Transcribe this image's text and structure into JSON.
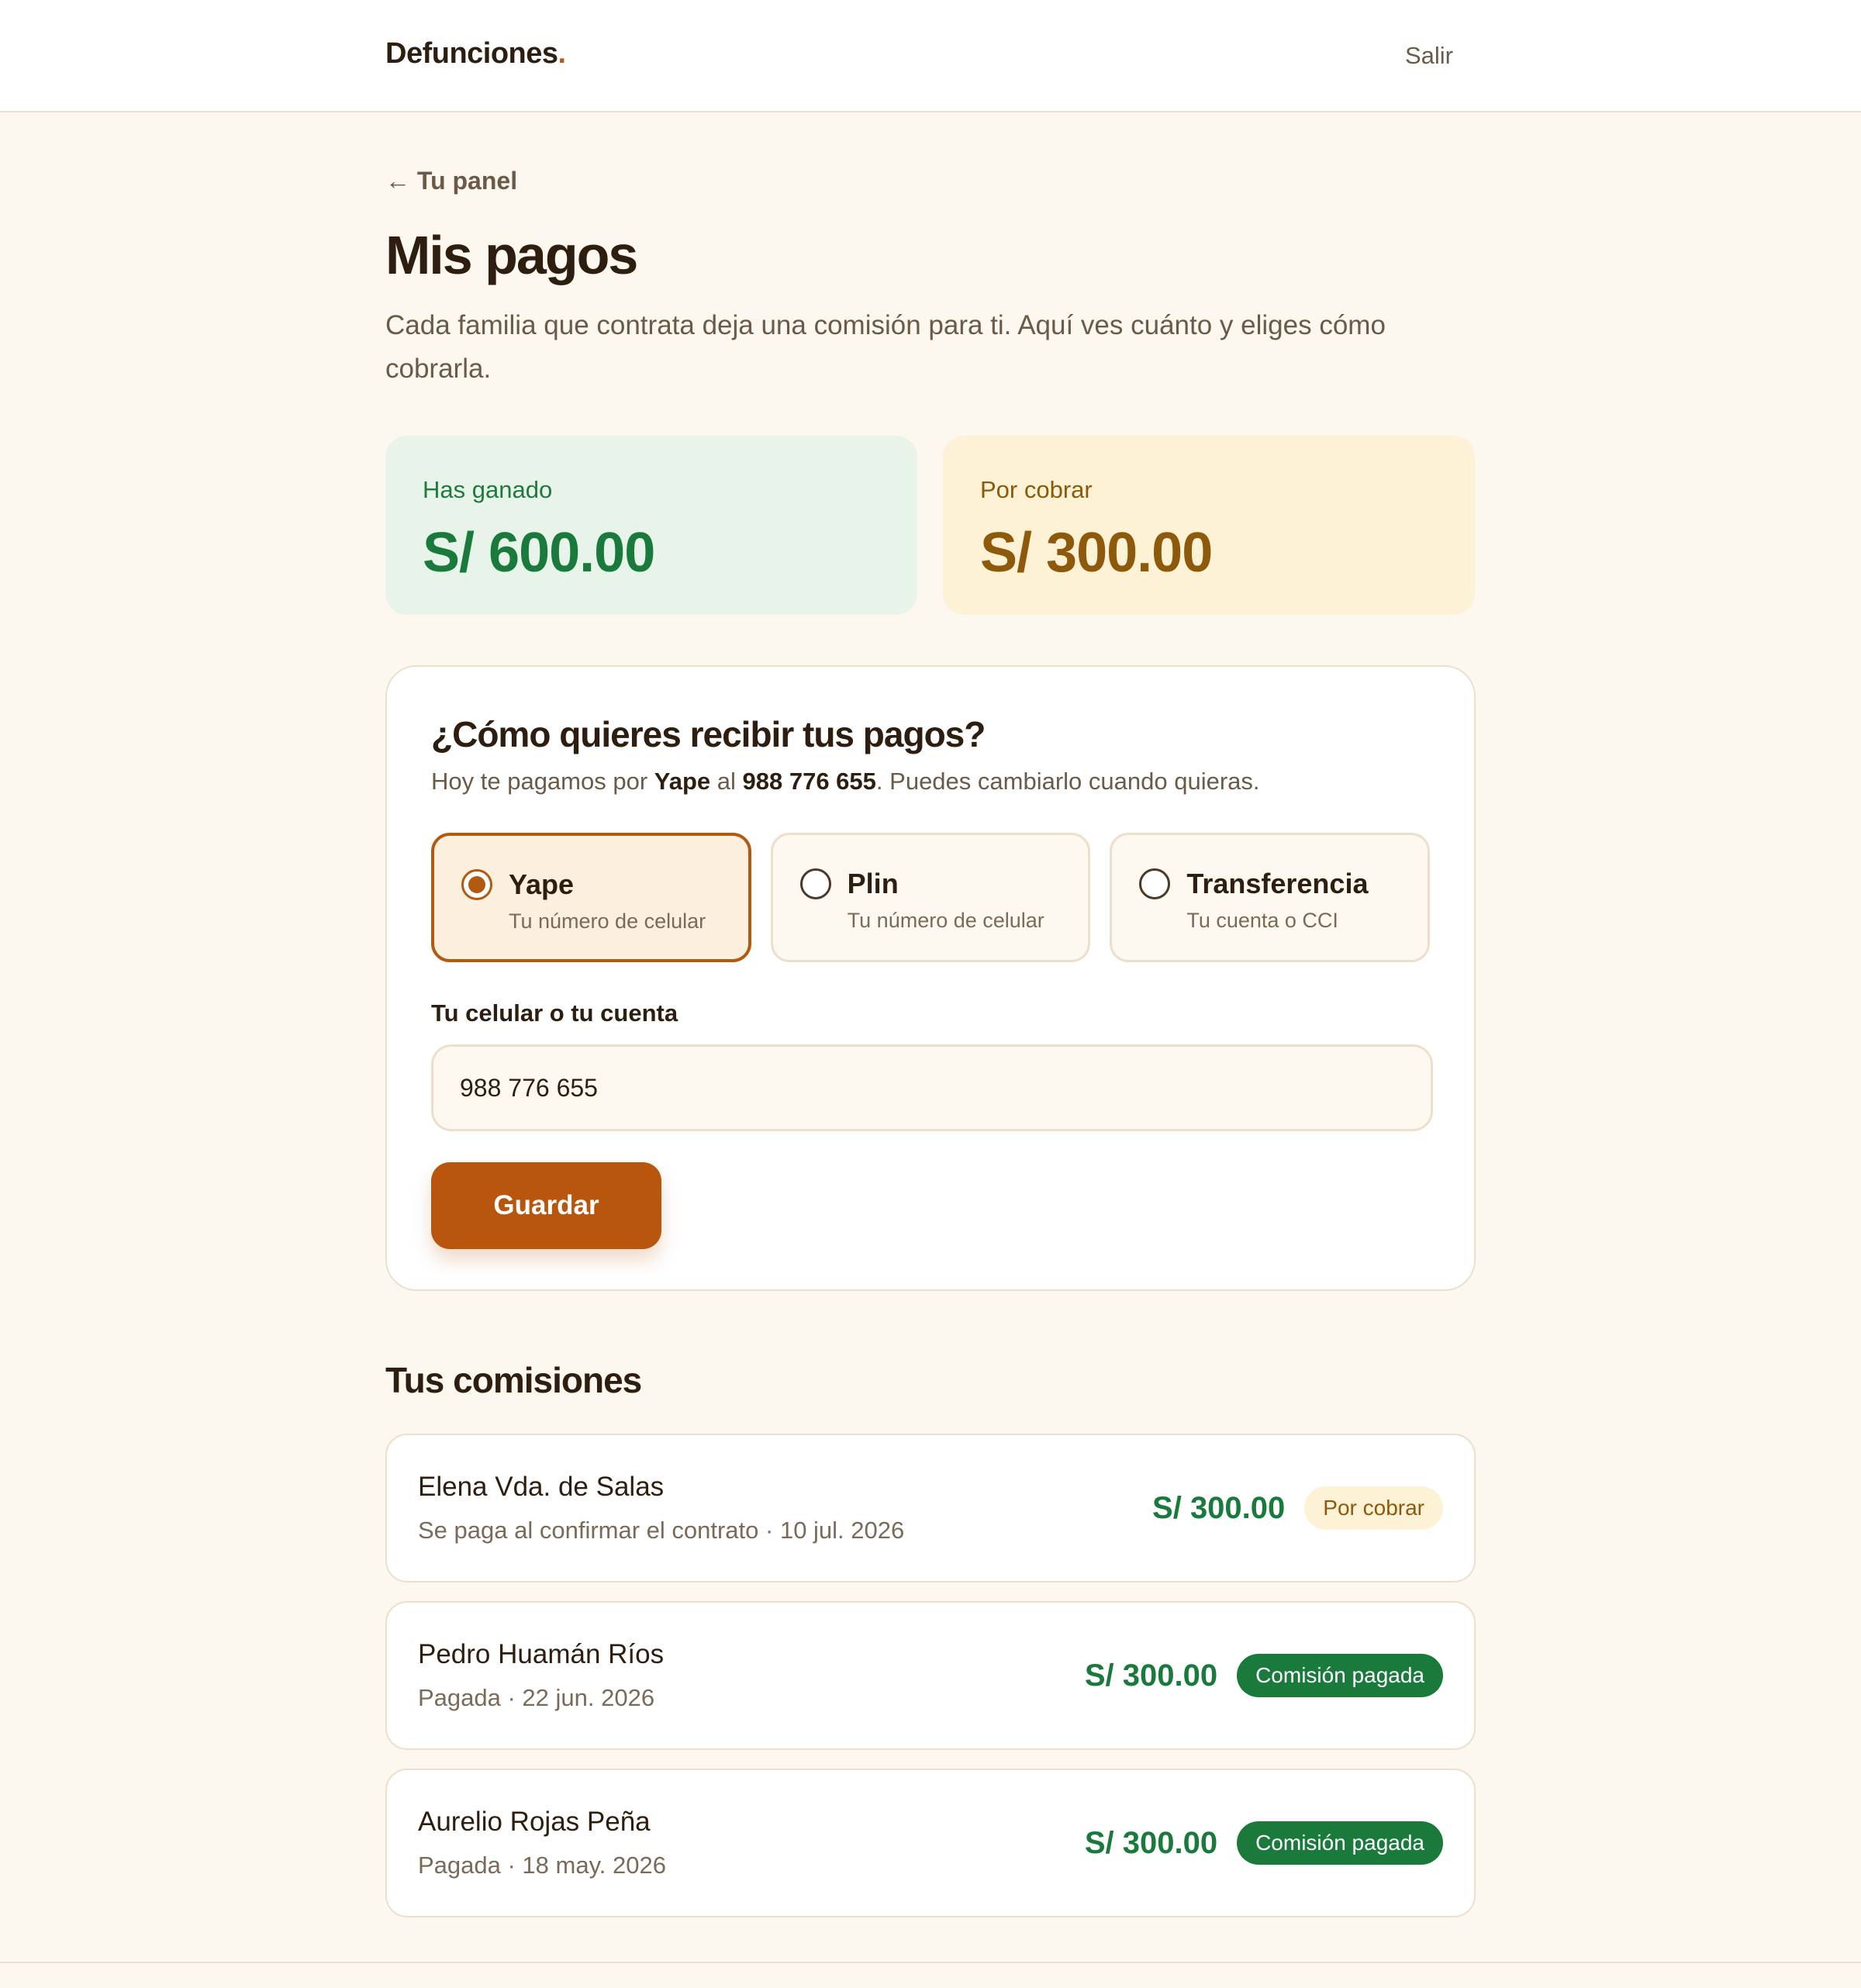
{
  "header": {
    "brand": "Defunciones",
    "brand_dot": ".",
    "logout_label": "Salir"
  },
  "nav": {
    "back_label": "← Tu panel"
  },
  "page": {
    "title": "Mis pagos",
    "description": "Cada familia que contrata deja una comisión para ti. Aquí ves cuánto y eliges cómo cobrarla."
  },
  "stats": {
    "earned": {
      "label": "Has ganado",
      "value": "S/ 600.00"
    },
    "pending": {
      "label": "Por cobrar",
      "value": "S/ 300.00"
    }
  },
  "payout": {
    "title": "¿Cómo quieres recibir tus pagos?",
    "sub_prefix": "Hoy te pagamos por ",
    "sub_method": "Yape",
    "sub_mid": " al ",
    "sub_number": "988 776 655",
    "sub_suffix": ". Puedes cambiarlo cuando quieras.",
    "methods": [
      {
        "name": "Yape",
        "hint": "Tu número de celular",
        "selected": true
      },
      {
        "name": "Plin",
        "hint": "Tu número de celular",
        "selected": false
      },
      {
        "name": "Transferencia",
        "hint": "Tu cuenta o CCI",
        "selected": false
      }
    ],
    "field_label": "Tu celular o tu cuenta",
    "field_value": "988 776 655",
    "save_label": "Guardar"
  },
  "commissions": {
    "title": "Tus comisiones",
    "items": [
      {
        "name": "Elena Vda. de Salas",
        "meta": "Se paga al confirmar el contrato · 10 jul. 2026",
        "amount": "S/ 300.00",
        "status": "Por cobrar",
        "status_kind": "pending"
      },
      {
        "name": "Pedro Huamán Ríos",
        "meta": "Pagada · 22 jun. 2026",
        "amount": "S/ 300.00",
        "status": "Comisión pagada",
        "status_kind": "paid"
      },
      {
        "name": "Aurelio Rojas Peña",
        "meta": "Pagada · 18 may. 2026",
        "amount": "S/ 300.00",
        "status": "Comisión pagada",
        "status_kind": "paid"
      }
    ]
  },
  "colors": {
    "accent": "#b8560e",
    "earned_green": "#1a7a3c",
    "pending_gold": "#8c5a0a",
    "background": "#fcf7ef"
  }
}
